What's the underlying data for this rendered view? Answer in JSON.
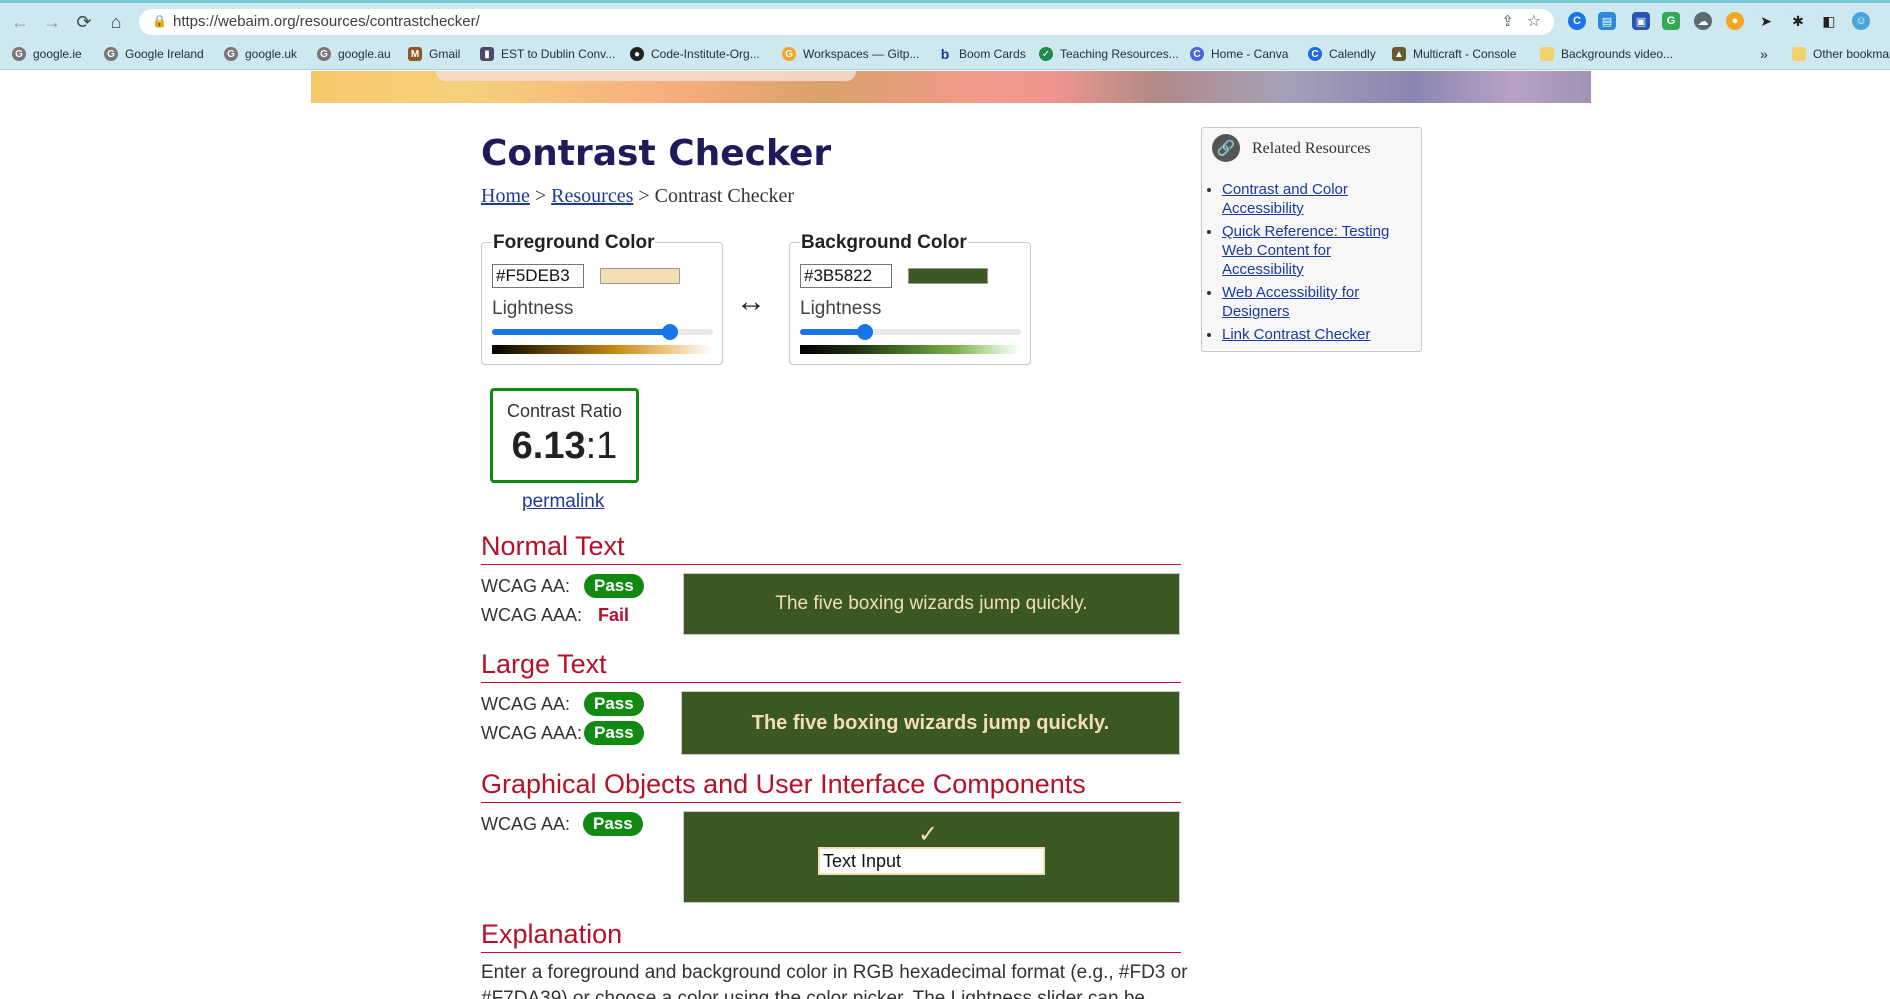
{
  "browser": {
    "url": "https://webaim.org/resources/contrastchecker/",
    "bookmarks": [
      "google.ie",
      "Google Ireland",
      "google.uk",
      "google.au",
      "Gmail",
      "EST to Dublin Conv...",
      "Code-Institute-Org...",
      "Workspaces — Gitp...",
      "Boom Cards",
      "Teaching Resources...",
      "Home - Canva",
      "Calendly",
      "Multicraft - Console",
      "Backgrounds video..."
    ],
    "overflow": "»",
    "other_bookmarks": "Other bookmarks"
  },
  "page": {
    "title": "Contrast Checker",
    "breadcrumb": {
      "home": "Home",
      "sep1": " > ",
      "resources": "Resources",
      "sep2": " > ",
      "current": "Contrast Checker"
    },
    "foreground": {
      "legend": "Foreground Color",
      "value": "#F5DEB3",
      "swatch": "#F5DEB3",
      "lightness_label": "Lightness",
      "lightness": 0.83
    },
    "background": {
      "legend": "Background Color",
      "value": "#3B5822",
      "swatch": "#3B5822",
      "lightness_label": "Lightness",
      "lightness": 0.28
    },
    "swap_icon": "↔",
    "contrast": {
      "label": "Contrast Ratio",
      "ratio": "6.13",
      "suffix": ":1",
      "permalink": "permalink"
    },
    "normal_text": {
      "heading": "Normal Text",
      "aa_label": "WCAG AA:",
      "aa": "Pass",
      "aaa_label": "WCAG AAA:",
      "aaa": "Fail",
      "sample": "The five boxing wizards jump quickly."
    },
    "large_text": {
      "heading": "Large Text",
      "aa_label": "WCAG AA:",
      "aa": "Pass",
      "aaa_label": "WCAG AAA:",
      "aaa": "Pass",
      "sample": "The five boxing wizards jump quickly."
    },
    "graphical": {
      "heading": "Graphical Objects and User Interface Components",
      "aa_label": "WCAG AA:",
      "aa": "Pass",
      "check": "✓",
      "input_value": "Text Input"
    },
    "explanation": {
      "heading": "Explanation",
      "text": "Enter a foreground and background color in RGB hexadecimal format (e.g., #FD3 or #F7DA39) or choose a color using the color picker. The Lightness slider can be used"
    },
    "related": {
      "title": "Related Resources",
      "links": [
        "Contrast and Color Accessibility",
        "Quick Reference: Testing Web Content for Accessibility",
        "Web Accessibility for Designers",
        "Link Contrast Checker"
      ]
    }
  },
  "colors": {
    "pass": "#128a12",
    "fail": "#b3122a",
    "link": "#1b3aa0",
    "heading": "#1f1a5a"
  }
}
